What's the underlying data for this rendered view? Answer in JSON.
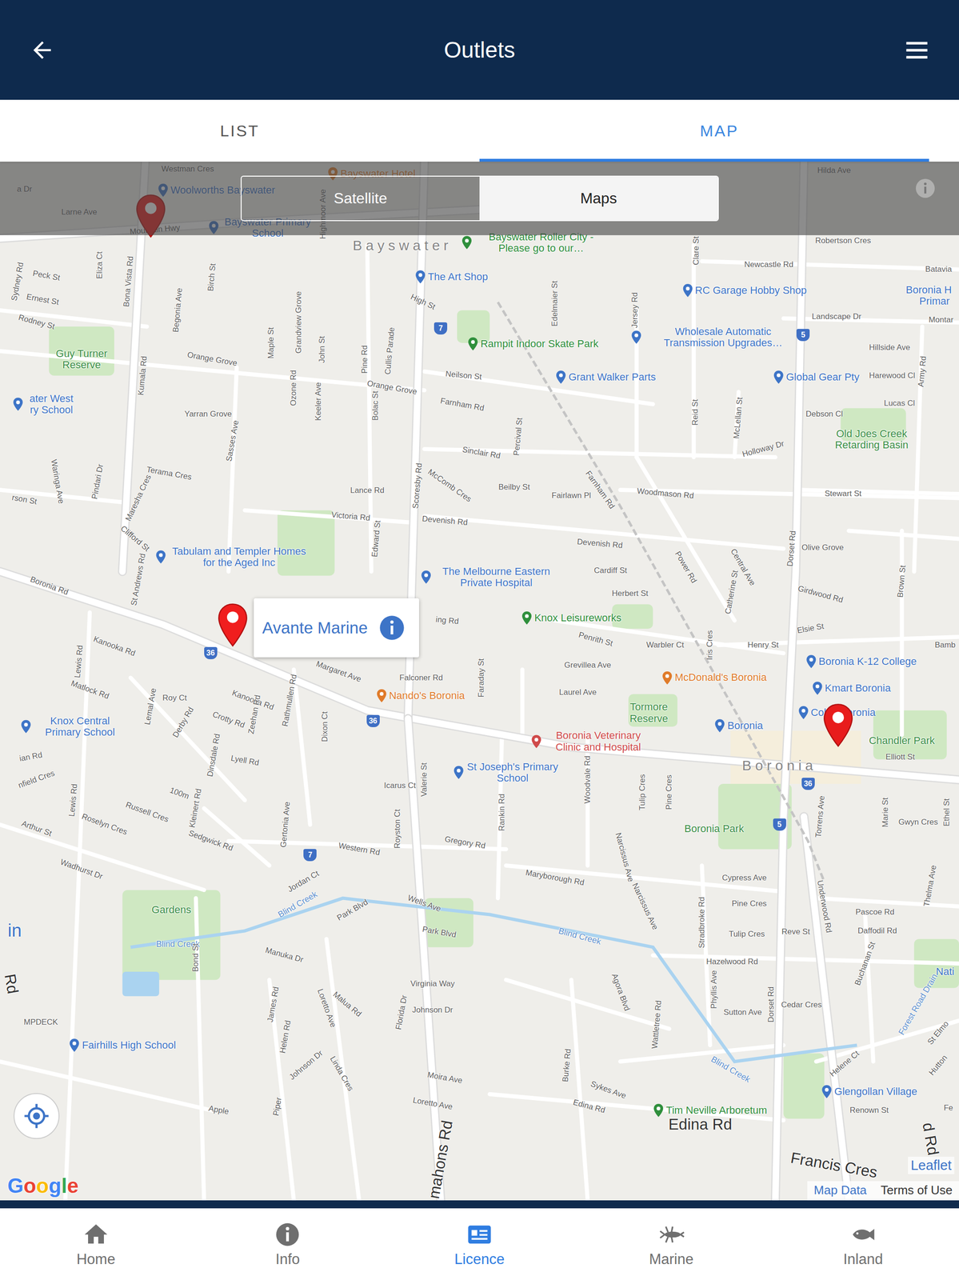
{
  "header": {
    "title": "Outlets"
  },
  "tabs": [
    {
      "label": "LIST",
      "selected": false
    },
    {
      "label": "MAP",
      "selected": true
    }
  ],
  "map_types": [
    {
      "label": "Satellite",
      "selected": false
    },
    {
      "label": "Maps",
      "selected": true
    }
  ],
  "map": {
    "labels": [
      {
        "text": "Westman Cres",
        "kind": "street"
      },
      {
        "text": "a Dr",
        "kind": "street"
      },
      {
        "text": "Woolworths Bayswater",
        "kind": "poi",
        "color": "#3d74c7"
      },
      {
        "text": "Bayswater Hotel",
        "kind": "poi",
        "color": "#e07b2a"
      },
      {
        "text": "Larne Ave",
        "kind": "street"
      },
      {
        "text": "Mountain Hwy",
        "kind": "street"
      },
      {
        "text": "Bayswater Primary School",
        "kind": "poi",
        "color": "#3d74c7"
      },
      {
        "text": "Bayswater",
        "kind": "place"
      },
      {
        "text": "Bayswater Roller City - Please go to our…",
        "kind": "poi",
        "color": "#2f8f3c"
      },
      {
        "text": "Highmoor Ave",
        "kind": "street"
      },
      {
        "text": "Hilda Ave",
        "kind": "street"
      },
      {
        "text": "Robertson Cres",
        "kind": "street"
      },
      {
        "text": "Peck St",
        "kind": "street"
      },
      {
        "text": "Ernest St",
        "kind": "street"
      },
      {
        "text": "Rodney St",
        "kind": "street"
      },
      {
        "text": "Sydney Rd",
        "kind": "street"
      },
      {
        "text": "Eliza Ct",
        "kind": "street"
      },
      {
        "text": "Bona Vista Rd",
        "kind": "street"
      },
      {
        "text": "Birch St",
        "kind": "street"
      },
      {
        "text": "Begonia Ave",
        "kind": "street"
      },
      {
        "text": "Maple St",
        "kind": "street"
      },
      {
        "text": "Grandview Grove",
        "kind": "street"
      },
      {
        "text": "John St",
        "kind": "street"
      },
      {
        "text": "Pine Rd",
        "kind": "street"
      },
      {
        "text": "Cullis Parade",
        "kind": "street"
      },
      {
        "text": "High St",
        "kind": "street"
      },
      {
        "text": "The Art Shop",
        "kind": "poi",
        "color": "#3d74c7"
      },
      {
        "text": "Edelmaier St",
        "kind": "street"
      },
      {
        "text": "Jersey Rd",
        "kind": "street"
      },
      {
        "text": "Clare St",
        "kind": "street"
      },
      {
        "text": "Newcastle Rd",
        "kind": "street"
      },
      {
        "text": "Batavia",
        "kind": "street"
      },
      {
        "text": "RC Garage Hobby Shop",
        "kind": "poi",
        "color": "#3d74c7"
      },
      {
        "text": "Boronia H",
        "kind": "label",
        "color": "#3d74c7"
      },
      {
        "text": "Primar",
        "kind": "label",
        "color": "#3d74c7"
      },
      {
        "text": "Landscape Dr",
        "kind": "street"
      },
      {
        "text": "Montar",
        "kind": "street"
      },
      {
        "text": "Wholesale Automatic Transmission Upgrades…",
        "kind": "poi",
        "color": "#3d74c7"
      },
      {
        "text": "Hillside Ave",
        "kind": "street"
      },
      {
        "text": "Rampit Indoor Skate Park",
        "kind": "poi",
        "color": "#2f8f3c"
      },
      {
        "text": "Guy Turner Reserve",
        "kind": "park"
      },
      {
        "text": "Orange Grove",
        "kind": "street"
      },
      {
        "text": "Orange Grove",
        "kind": "street"
      },
      {
        "text": "Neilson St",
        "kind": "street"
      },
      {
        "text": "Grant Walker Parts",
        "kind": "poi",
        "color": "#3d74c7"
      },
      {
        "text": "Global Gear Pty",
        "kind": "poi",
        "color": "#3d74c7"
      },
      {
        "text": "Harewood Cl",
        "kind": "street"
      },
      {
        "text": "Army Rd",
        "kind": "street"
      },
      {
        "text": "Lucas Cl",
        "kind": "street"
      },
      {
        "text": "Farnham Rd",
        "kind": "street"
      },
      {
        "text": "Kumala Rd",
        "kind": "street"
      },
      {
        "text": "Ozone Rd",
        "kind": "street"
      },
      {
        "text": "Keeler Ave",
        "kind": "street"
      },
      {
        "text": "Bolac St",
        "kind": "street"
      },
      {
        "text": "Debson Cl",
        "kind": "street"
      },
      {
        "text": "Old Joes Creek Retarding Basin",
        "kind": "park"
      },
      {
        "text": "Reid St",
        "kind": "street"
      },
      {
        "text": "McLellan St",
        "kind": "street"
      },
      {
        "text": "ater West ry School",
        "kind": "poi",
        "color": "#3d74c7"
      },
      {
        "text": "Yarran Grove",
        "kind": "street"
      },
      {
        "text": "Sinclair Rd",
        "kind": "street"
      },
      {
        "text": "Percival St",
        "kind": "street"
      },
      {
        "text": "Holloway Dr",
        "kind": "street"
      },
      {
        "text": "Sasses Ave",
        "kind": "street"
      },
      {
        "text": "McComb Cres",
        "kind": "street"
      },
      {
        "text": "Scoresby Rd",
        "kind": "street"
      },
      {
        "text": "Beilby St",
        "kind": "street"
      },
      {
        "text": "Fairlawn Pl",
        "kind": "street"
      },
      {
        "text": "Farnham Rd",
        "kind": "street"
      },
      {
        "text": "Woodmason Rd",
        "kind": "street"
      },
      {
        "text": "Stewart St",
        "kind": "street"
      },
      {
        "text": "Terama Cres",
        "kind": "street"
      },
      {
        "text": "Pindari Dr",
        "kind": "street"
      },
      {
        "text": "Maresha Cres",
        "kind": "street"
      },
      {
        "text": "Waringa Ave",
        "kind": "street"
      },
      {
        "text": "rson St",
        "kind": "street"
      },
      {
        "text": "Lance Rd",
        "kind": "street"
      },
      {
        "text": "Victoria Rd",
        "kind": "street"
      },
      {
        "text": "Devenish Rd",
        "kind": "street"
      },
      {
        "text": "Devenish Rd",
        "kind": "street"
      },
      {
        "text": "Edward St",
        "kind": "street"
      },
      {
        "text": "Clifford St",
        "kind": "street"
      },
      {
        "text": "Tabulam and Templer Homes for the Aged Inc",
        "kind": "poi",
        "color": "#3d74c7"
      },
      {
        "text": "The Melbourne Eastern Private Hospital",
        "kind": "poi",
        "color": "#3d74c7"
      },
      {
        "text": "Cardiff St",
        "kind": "street"
      },
      {
        "text": "Herbert St",
        "kind": "street"
      },
      {
        "text": "Power Rd",
        "kind": "street"
      },
      {
        "text": "Central Ave",
        "kind": "street"
      },
      {
        "text": "Catherine St",
        "kind": "street"
      },
      {
        "text": "Dorset Rd",
        "kind": "street"
      },
      {
        "text": "Olive Grove",
        "kind": "street"
      },
      {
        "text": "Girdwood Rd",
        "kind": "street"
      },
      {
        "text": "Brown St",
        "kind": "street"
      },
      {
        "text": "Boronia Rd",
        "kind": "street"
      },
      {
        "text": "St Andrews Rd",
        "kind": "street"
      },
      {
        "text": "ing Rd",
        "kind": "street"
      },
      {
        "text": "Knox Leisureworks",
        "kind": "poi",
        "color": "#2f8f3c"
      },
      {
        "text": "Penrith St",
        "kind": "street"
      },
      {
        "text": "Warbler Ct",
        "kind": "street"
      },
      {
        "text": "Iris Cres",
        "kind": "street"
      },
      {
        "text": "Henry St",
        "kind": "street"
      },
      {
        "text": "Elsie St",
        "kind": "street"
      },
      {
        "text": "Bamb",
        "kind": "street"
      },
      {
        "text": "Kanooka Rd",
        "kind": "street"
      },
      {
        "text": "Lewis Rd",
        "kind": "street"
      },
      {
        "text": "Matlock Rd",
        "kind": "street"
      },
      {
        "text": "Margaret Ave",
        "kind": "street"
      },
      {
        "text": "Falconer Rd",
        "kind": "street"
      },
      {
        "text": "Grevillea Ave",
        "kind": "street"
      },
      {
        "text": "Laurel Ave",
        "kind": "street"
      },
      {
        "text": "Faraday St",
        "kind": "street"
      },
      {
        "text": "Boronia K-12 College",
        "kind": "poi",
        "color": "#3d74c7"
      },
      {
        "text": "McDonald's Boronia",
        "kind": "poi",
        "color": "#e07b2a"
      },
      {
        "text": "Kmart Boronia",
        "kind": "poi",
        "color": "#3d74c7"
      },
      {
        "text": "Nando's Boronia",
        "kind": "poi",
        "color": "#e07b2a"
      },
      {
        "text": "Roy Ct",
        "kind": "street"
      },
      {
        "text": "Kanooka Rd",
        "kind": "street"
      },
      {
        "text": "Rathmullen Rd",
        "kind": "street"
      },
      {
        "text": "Lemal Ave",
        "kind": "street"
      },
      {
        "text": "Derby Rd",
        "kind": "street"
      },
      {
        "text": "Crotty Rd",
        "kind": "street"
      },
      {
        "text": "Zeehan Rd",
        "kind": "street"
      },
      {
        "text": "Dixon Ct",
        "kind": "street"
      },
      {
        "text": "Knox Central Primary School",
        "kind": "poi",
        "color": "#3d74c7"
      },
      {
        "text": "Tormore Reserve",
        "kind": "park"
      },
      {
        "text": "Boronia",
        "kind": "poi",
        "color": "#3d74c7"
      },
      {
        "text": "Coles Boronia",
        "kind": "poi",
        "color": "#3d74c7"
      },
      {
        "text": "Chandler Park",
        "kind": "park"
      },
      {
        "text": "Elliott St",
        "kind": "street"
      },
      {
        "text": "Boronia Veterinary Clinic and Hospital",
        "kind": "poi",
        "color": "#d04a4a"
      },
      {
        "text": "Lyell Rd",
        "kind": "street"
      },
      {
        "text": "Dinsdale Rd",
        "kind": "street"
      },
      {
        "text": "St Joseph's Primary School",
        "kind": "poi",
        "color": "#3d74c7"
      },
      {
        "text": "Boronia",
        "kind": "place"
      },
      {
        "text": "ian Rd",
        "kind": "street"
      },
      {
        "text": "nfield Cres",
        "kind": "street"
      },
      {
        "text": "Lewis Rd",
        "kind": "street"
      },
      {
        "text": "Icarus Ct",
        "kind": "street"
      },
      {
        "text": "Valerie St",
        "kind": "street"
      },
      {
        "text": "Woodvale Rd",
        "kind": "street"
      },
      {
        "text": "Tulip Cres",
        "kind": "street"
      },
      {
        "text": "Pine Cres",
        "kind": "street"
      },
      {
        "text": "Marie St",
        "kind": "street"
      },
      {
        "text": "Gwyn Cres",
        "kind": "street"
      },
      {
        "text": "Ethel St",
        "kind": "street"
      },
      {
        "text": "Arthur St",
        "kind": "street"
      },
      {
        "text": "Russell Cres",
        "kind": "street"
      },
      {
        "text": "Roselyn Cres",
        "kind": "street"
      },
      {
        "text": "Kleinert Rd",
        "kind": "street"
      },
      {
        "text": "Sedgwick Rd",
        "kind": "street"
      },
      {
        "text": "Gertonia Ave",
        "kind": "street"
      },
      {
        "text": "Royston Ct",
        "kind": "street"
      },
      {
        "text": "Gregory Rd",
        "kind": "street"
      },
      {
        "text": "Rankin Rd",
        "kind": "street"
      },
      {
        "text": "Boronia Park",
        "kind": "park"
      },
      {
        "text": "Torrens Ave",
        "kind": "street"
      },
      {
        "text": "Western Rd",
        "kind": "street"
      },
      {
        "text": "Maryborough Rd",
        "kind": "street"
      },
      {
        "text": "Cypress Ave",
        "kind": "street"
      },
      {
        "text": "Wadhurst Dr",
        "kind": "street"
      },
      {
        "text": "Jordan Ct",
        "kind": "street"
      },
      {
        "text": "Gardens",
        "kind": "park"
      },
      {
        "text": "Wells Ave",
        "kind": "street"
      },
      {
        "text": "Blind Creek",
        "kind": "water"
      },
      {
        "text": "Park Blvd",
        "kind": "street"
      },
      {
        "text": "Park Blvd",
        "kind": "street"
      },
      {
        "text": "Blind Creek",
        "kind": "water"
      },
      {
        "text": "Narcissus Ave",
        "kind": "street"
      },
      {
        "text": "Narcissus Ave",
        "kind": "street"
      },
      {
        "text": "Pine Cres",
        "kind": "street"
      },
      {
        "text": "Stradbroke Rd",
        "kind": "street"
      },
      {
        "text": "Tulip Cres",
        "kind": "street"
      },
      {
        "text": "Reve St",
        "kind": "street"
      },
      {
        "text": "Pascoe Rd",
        "kind": "street"
      },
      {
        "text": "Daffodil Rd",
        "kind": "street"
      },
      {
        "text": "Underwood Rd",
        "kind": "street"
      },
      {
        "text": "Thelma Ave",
        "kind": "street"
      },
      {
        "text": "Blind Creek",
        "kind": "water"
      },
      {
        "text": "Bond St",
        "kind": "street"
      },
      {
        "text": "Manuka Dr",
        "kind": "street"
      },
      {
        "text": "Virginia Way",
        "kind": "street"
      },
      {
        "text": "Johnson Dr",
        "kind": "street"
      },
      {
        "text": "Florida Dr",
        "kind": "street"
      },
      {
        "text": "Hazelwood Rd",
        "kind": "street"
      },
      {
        "text": "Phyllis Ave",
        "kind": "street"
      },
      {
        "text": "Sutton Ave",
        "kind": "street"
      },
      {
        "text": "Dorset Rd",
        "kind": "street"
      },
      {
        "text": "Cedar Cres",
        "kind": "street"
      },
      {
        "text": "Buchanan St",
        "kind": "street"
      },
      {
        "text": "Forest Road Drain",
        "kind": "water"
      },
      {
        "text": "Nati",
        "kind": "label",
        "color": "#3d74c7"
      },
      {
        "text": "in",
        "kind": "area"
      },
      {
        "text": "MPDECK",
        "kind": "street"
      },
      {
        "text": "Fairhills High School",
        "kind": "poi",
        "color": "#3d74c7"
      },
      {
        "text": "Agora Blvd",
        "kind": "street"
      },
      {
        "text": "Wattletree Rd",
        "kind": "street"
      },
      {
        "text": "Blind Creek",
        "kind": "water"
      },
      {
        "text": "Helene Ct",
        "kind": "street"
      },
      {
        "text": "Sykes Ave",
        "kind": "street"
      },
      {
        "text": "Burke Rd",
        "kind": "street"
      },
      {
        "text": "Moira Ave",
        "kind": "street"
      },
      {
        "text": "Loretto Ave",
        "kind": "street"
      },
      {
        "text": "Edina Rd",
        "kind": "street"
      },
      {
        "text": "Tim Neville Arboretum",
        "kind": "poi",
        "color": "#2f8f3c"
      },
      {
        "text": "Edina Rd",
        "kind": "big"
      },
      {
        "text": "Glengollan Village",
        "kind": "poi",
        "color": "#3d74c7"
      },
      {
        "text": "Renown St",
        "kind": "street"
      },
      {
        "text": "Francis Cres",
        "kind": "big"
      },
      {
        "text": "d Rd",
        "kind": "big"
      },
      {
        "text": "Fe",
        "kind": "street"
      },
      {
        "text": "St Elmo",
        "kind": "street"
      },
      {
        "text": "Hutton",
        "kind": "street"
      },
      {
        "text": "Rd",
        "kind": "big"
      },
      {
        "text": "mahons Rd",
        "kind": "big"
      },
      {
        "text": "James Rd",
        "kind": "street"
      },
      {
        "text": "Helen Rd",
        "kind": "street"
      },
      {
        "text": "Loretto Ave",
        "kind": "street"
      },
      {
        "text": "Malua Rd",
        "kind": "street"
      },
      {
        "text": "Johnson Dr",
        "kind": "street"
      },
      {
        "text": "Linda Cres",
        "kind": "street"
      },
      {
        "text": "Apple",
        "kind": "street"
      },
      {
        "text": "Piper",
        "kind": "street"
      },
      {
        "text": "100m",
        "kind": "street"
      },
      {
        "text": "36",
        "kind": "shield"
      },
      {
        "text": "36",
        "kind": "shield"
      },
      {
        "text": "36",
        "kind": "shield"
      },
      {
        "text": "5",
        "kind": "shield"
      },
      {
        "text": "7",
        "kind": "shield"
      },
      {
        "text": "5",
        "kind": "shield"
      },
      {
        "text": "7",
        "kind": "shield"
      }
    ],
    "pins": [
      {
        "selected": false
      },
      {
        "selected": true,
        "label": "Avante Marine"
      },
      {
        "selected": false
      }
    ],
    "attribution": {
      "logo": "Google",
      "leaflet": "Leaflet",
      "links": [
        "Map Data",
        "Terms of Use"
      ]
    }
  },
  "nav": [
    {
      "label": "Home",
      "selected": false
    },
    {
      "label": "Info",
      "selected": false
    },
    {
      "label": "Licence",
      "selected": true
    },
    {
      "label": "Marine",
      "selected": false
    },
    {
      "label": "Inland",
      "selected": false
    }
  ]
}
